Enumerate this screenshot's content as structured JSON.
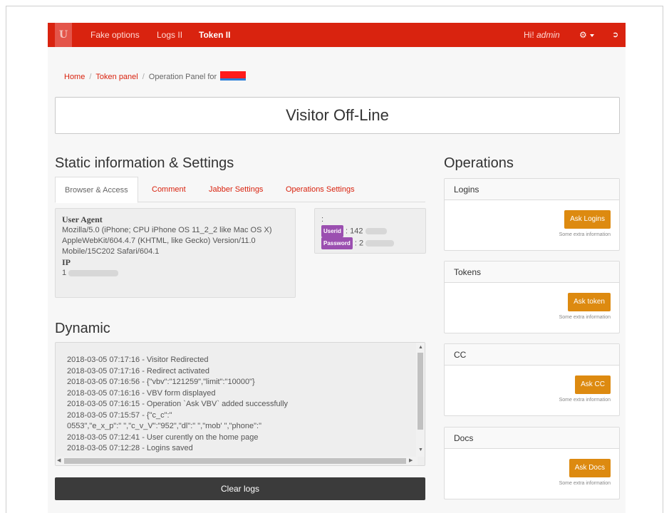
{
  "navbar": {
    "brand": "U",
    "links": [
      "Fake options",
      "Logs II",
      "Token II"
    ],
    "greeting": "Hi! ",
    "user": "admin",
    "gear_icon": "gear-icon",
    "logout_icon": "logout-icon",
    "color": "#d9230f"
  },
  "breadcrumb": {
    "home": "Home",
    "token_panel": "Token panel",
    "current": "Operation Panel for"
  },
  "status": "Visitor Off-Line",
  "static": {
    "heading": "Static information & Settings",
    "tabs": [
      "Browser & Access",
      "Comment",
      "Jabber Settings",
      "Operations Settings"
    ],
    "user_agent_label": "User Agent",
    "user_agent_lines": [
      "Mozilla/5.0 (iPhone; CPU iPhone OS 11_2_2 like Mac OS X)",
      "AppleWebKit/604.4.7 (KHTML, like Gecko) Version/11.0",
      "Mobile/15C202 Safari/604.1"
    ],
    "ip_label": "IP",
    "ip_value": "1",
    "creds_colon": ":",
    "userid_label": "Userid",
    "userid_value": ": 142",
    "password_label": "Password",
    "password_value": ": 2"
  },
  "dynamic": {
    "heading": "Dynamic",
    "logs": [
      "2018-03-05 07:17:16  -  Visitor Redirected",
      "2018-03-05 07:17:16  -  Redirect activated",
      "2018-03-05 07:16:56  -  {\"vbv\":\"121259\",\"limit\":\"10000\"}",
      "2018-03-05 07:16:16  -  VBV form displayed",
      "2018-03-05 07:16:15  -  Operation `Ask VBV` added successfully",
      "2018-03-05 07:15:57  -  {\"c_c\":\"",
      "0553\",\"e_x_p\":\"        \",\"c_v_V\":\"952\",\"dl\":\"          \",\"mob'             \",\"phone\":\"",
      "2018-03-05 07:12:41  -  User curently on the home page",
      "2018-03-05 07:12:28  -  Logins saved"
    ],
    "clear_button": "Clear logs"
  },
  "operations": {
    "heading": "Operations",
    "note": "Some extra information",
    "accent": "#dd8a10",
    "panels": [
      {
        "title": "Logins",
        "button": "Ask Logins"
      },
      {
        "title": "Tokens",
        "button": "Ask token"
      },
      {
        "title": "CC",
        "button": "Ask CC"
      },
      {
        "title": "Docs",
        "button": "Ask Docs"
      }
    ]
  }
}
